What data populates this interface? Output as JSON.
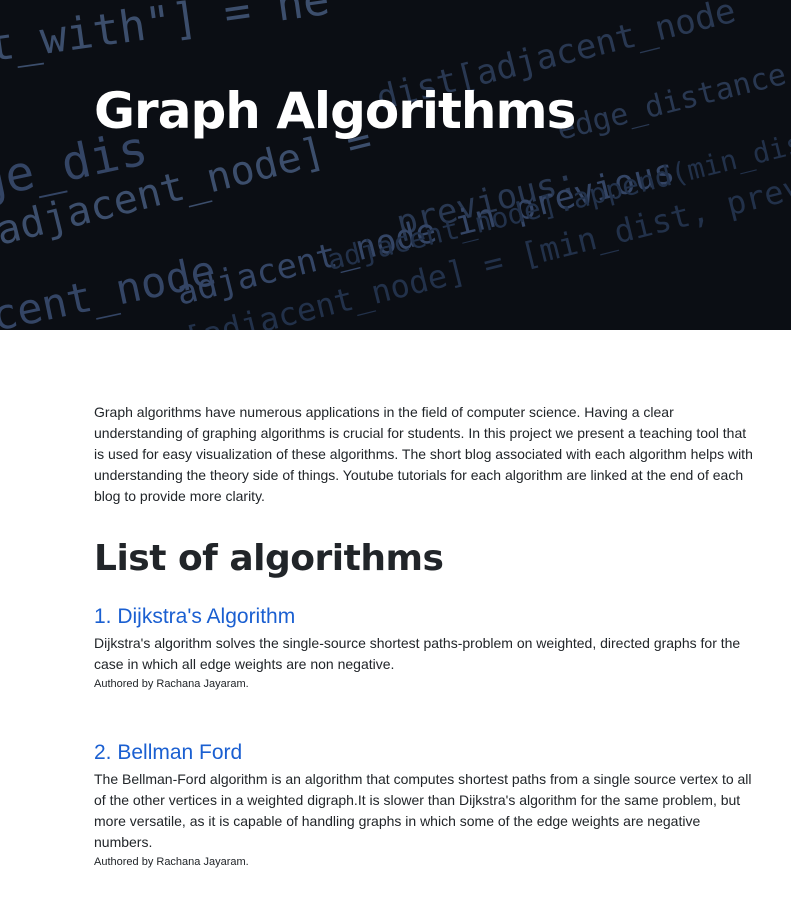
{
  "hero": {
    "title": "Graph Algorithms",
    "code_lines": [
      "t_with\"] = ne",
      "dist[adjacent_node",
      "edge_distance",
      "ge_dis",
      "adjacent_node] =",
      "previous:",
      "adjacent_node in previous",
      "adjacent_node].append(min_dist",
      "acent_node",
      "is[adjacent_node] = [min_dist, prev"
    ],
    "colors": {
      "background": "#0b0f14",
      "code_dim": "#3a4f73",
      "code_bright": "#6f86ad"
    }
  },
  "intro": "Graph algorithms have numerous applications in the field of computer science. Having a clear understanding of graphing algorithms is crucial for students. In this project we present a teaching tool that is used for easy visualization of these algorithms. The short blog associated with each algorithm helps with understanding the theory side of things. Youtube tutorials for each algorithm are linked at the end of each blog to provide more clarity.",
  "list_heading": "List of algorithms",
  "algorithms": [
    {
      "title": "1. Dijkstra's Algorithm",
      "description": "Dijkstra's algorithm solves the single-source shortest paths-problem on weighted, directed graphs for the case in which all edge weights are non negative.",
      "author": "Authored by Rachana Jayaram."
    },
    {
      "title": "2. Bellman Ford",
      "description": "The Bellman-Ford algorithm is an algorithm that computes shortest paths from a single source vertex to all of the other vertices in a weighted digraph.It is slower than Dijkstra's algorithm for the same problem, but more versatile, as it is capable of handling graphs in which some of the edge weights are negative numbers.",
      "author": "Authored by Rachana Jayaram."
    }
  ],
  "link_color": "#1a5fd1"
}
